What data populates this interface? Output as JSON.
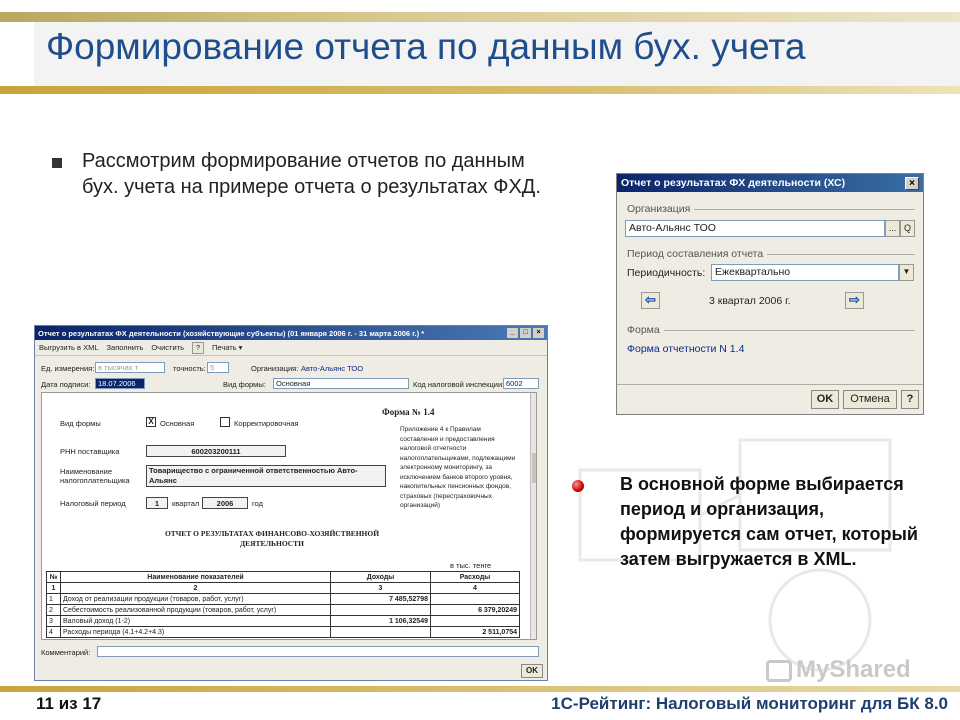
{
  "slide": {
    "title": "Формирование отчета по данным бух. учета",
    "bullet1": "Рассмотрим формирование отчетов по данным бух. учета на примере отчета о результатах ФХД.",
    "bullet2": "В основной форме выбирается период и организация, формируется сам отчет, который затем выгружается в XML.",
    "footer_left": "11 из 17",
    "footer_right": "1С-Рейтинг: Налоговый мониторинг для БК 8.0",
    "watermark": "MyShared"
  },
  "dialog": {
    "title": "Отчет о результатах ФХ деятельности (ХС)",
    "close": "×",
    "org_group": "Организация",
    "org_value": "Авто-Альянс ТОО",
    "org_select_btn": "...",
    "org_open_btn": "Q",
    "period_group": "Период составления отчета",
    "periodicity_label": "Периодичность:",
    "periodicity_value": "Ежеквартально",
    "prev_btn": "⇦",
    "next_btn": "⇨",
    "period_value": "3 квартал 2006 г.",
    "form_group": "Форма",
    "form_link": "Форма отчетности N 1.4",
    "ok": "OK",
    "cancel": "Отмена",
    "help": "?"
  },
  "report": {
    "title": "Отчет о результатах ФХ деятельности (хозяйствующие субъекты) (01 января 2006 г. - 31 марта 2006 г.) *",
    "win_buttons": [
      "_",
      "□",
      "×"
    ],
    "toolbar": {
      "export": "Выгрузить в XML",
      "fill": "Заполнить",
      "clear": "Очистить",
      "help": "?",
      "print": "Печать ▾"
    },
    "unit_label": "Ед. измерения:",
    "unit_value": "в тысячах т",
    "precision_label": "точность:",
    "precision_value": "5",
    "org_label": "Организация:",
    "org_value": "Авто-Альянс ТОО",
    "date_label": "Дата подписи:",
    "date_value": "18.07.2006",
    "form_type_label": "Вид формы:",
    "form_type_value": "Основная",
    "tax_code_label": "Код налоговой инспекции:",
    "tax_code_value": "6002",
    "paper": {
      "form_kind_label": "Вид формы",
      "check_mark": "X",
      "main_label": "Основная",
      "corrective_label": "Корректировочная",
      "form_number": "Форма № 1.4",
      "rnn_label": "РНН поставщика",
      "rnn_value": "600203200111",
      "taxpayer_label": "Наименование налогоплательщика",
      "taxpayer_value": "Товарищество с ограниченной ответственностью Авто-Альянс",
      "period_label": "Налоговый период",
      "quarter_value": "1",
      "quarter_label": "квартал",
      "year_value": "2006",
      "year_label": "год",
      "appendix": "Приложение 4 к Правилам составления и предоставления налоговой отчетности налогоплательщиками, подлежащими электронному мониторингу, за исключением банков второго уровня, накопительных пенсионных фондов, страховых (перестраховочных организаций)",
      "report_title": "ОТЧЕТ О РЕЗУЛЬТАТАХ ФИНАНСОВО-ХОЗЯЙСТВЕННОЙ ДЕЯТЕЛЬНОСТИ",
      "units": "в тыс. тенге",
      "headers": [
        "№",
        "Наименование показателей",
        "Доходы",
        "Расходы"
      ],
      "header_nums": [
        "1",
        "2",
        "3",
        "4"
      ],
      "rows": [
        [
          "1",
          "Доход от реализации продукции (товаров, работ, услуг)",
          "7 485,52798",
          ""
        ],
        [
          "2",
          "Себестоимость реализованной продукции (товаров, работ, услуг)",
          "",
          "6 379,20249"
        ],
        [
          "3",
          "Валовый доход (1-2)",
          "1 106,32549",
          ""
        ],
        [
          "4",
          "Расходы периода (4.1+4.2+4.3)",
          "",
          "2 511,0754"
        ]
      ]
    },
    "comment_label": "Комментарий:",
    "ok": "OK"
  }
}
